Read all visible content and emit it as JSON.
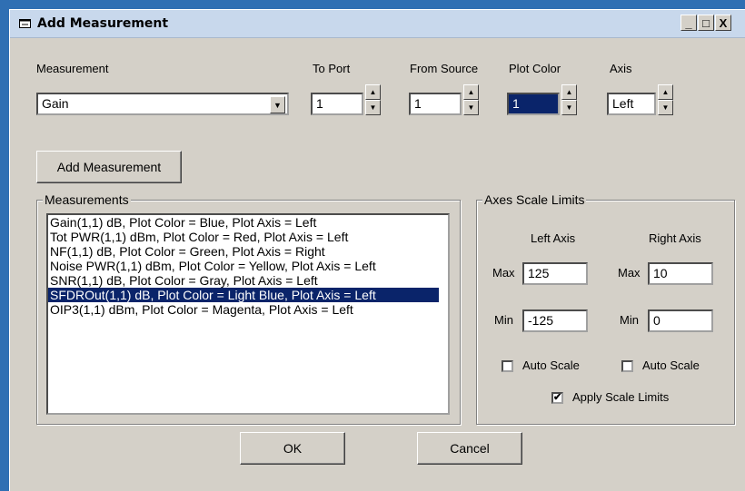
{
  "window": {
    "title": "Add Measurement",
    "minimize": "_",
    "maximize": "□",
    "close": "X"
  },
  "top": {
    "measurement_label": "Measurement",
    "measurement_value": "Gain",
    "to_port_label": "To Port",
    "to_port_value": "1",
    "from_source_label": "From Source",
    "from_source_value": "1",
    "plot_color_label": "Plot Color",
    "plot_color_value": "1",
    "axis_label": "Axis",
    "axis_value": "Left",
    "add_button": "Add Measurement"
  },
  "measurements": {
    "title": "Measurements",
    "items": [
      "Gain(1,1) dB,  Plot Color = Blue,  Plot Axis = Left",
      "Tot PWR(1,1) dBm,  Plot Color = Red,  Plot Axis = Left",
      "NF(1,1) dB,  Plot Color = Green,  Plot Axis = Right",
      "Noise PWR(1,1) dBm,  Plot Color = Yellow,  Plot Axis = Left",
      "SNR(1,1) dB,  Plot Color = Gray,  Plot Axis = Left",
      "SFDROut(1,1) dB,  Plot Color = Light Blue,  Plot Axis = Left",
      "OIP3(1,1) dBm,  Plot Color = Magenta,  Plot Axis = Left"
    ],
    "selected_index": 5
  },
  "axes": {
    "title": "Axes Scale Limits",
    "left_axis_label": "Left Axis",
    "right_axis_label": "Right Axis",
    "max_label": "Max",
    "min_label": "Min",
    "left_max": "125",
    "left_min": "-125",
    "right_max": "10",
    "right_min": "0",
    "auto_scale_label": "Auto Scale",
    "apply_scale_limits_label": "Apply Scale Limits",
    "check_mark": "✔"
  },
  "footer": {
    "ok": "OK",
    "cancel": "Cancel"
  }
}
